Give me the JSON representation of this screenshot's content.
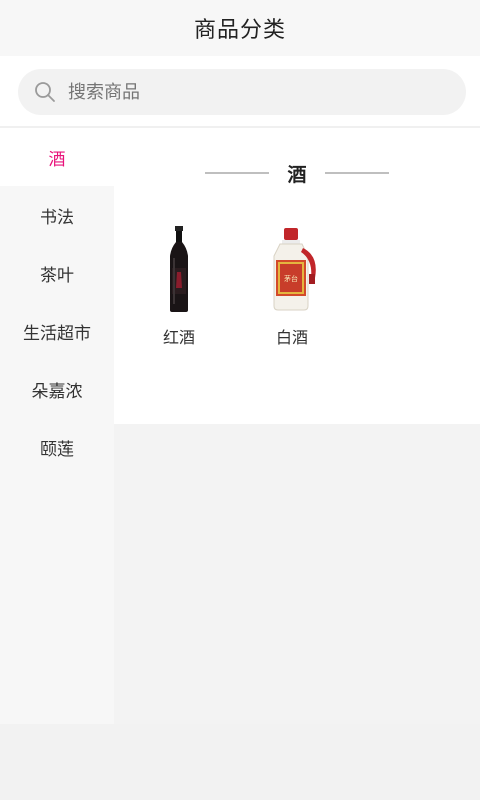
{
  "header": {
    "title": "商品分类"
  },
  "search": {
    "placeholder": "搜索商品"
  },
  "sidebar": {
    "items": [
      {
        "label": "酒",
        "active": true
      },
      {
        "label": "书法",
        "active": false
      },
      {
        "label": "茶叶",
        "active": false
      },
      {
        "label": "生活超市",
        "active": false
      },
      {
        "label": "朵嘉浓",
        "active": false
      },
      {
        "label": "颐莲",
        "active": false
      }
    ]
  },
  "content": {
    "section_title": "酒",
    "products": [
      {
        "name": "红酒",
        "icon": "red-wine-bottle-icon"
      },
      {
        "name": "白酒",
        "icon": "baijiu-bottle-icon"
      }
    ]
  },
  "colors": {
    "accent": "#e8127a",
    "sidebar_bg": "#f7f7f7",
    "content_bg": "#ffffff"
  }
}
